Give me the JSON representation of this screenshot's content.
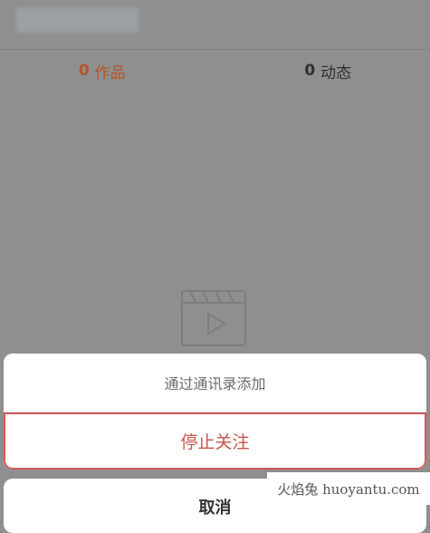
{
  "profile": {
    "name_label": ""
  },
  "tabs": [
    {
      "count": "0",
      "label": "作品"
    },
    {
      "count": "0",
      "label": "动态"
    }
  ],
  "action_sheet": {
    "options": [
      {
        "label": "通过通讯录添加"
      },
      {
        "label": "停止关注"
      }
    ],
    "cancel_label": "取消"
  },
  "watermark": {
    "text": "火焰兔 huoyantu.com"
  },
  "colors": {
    "accent": "#b5542a",
    "danger": "#c9534b",
    "overlay": "#8f8f8f",
    "sheet_bg": "#ffffff"
  }
}
